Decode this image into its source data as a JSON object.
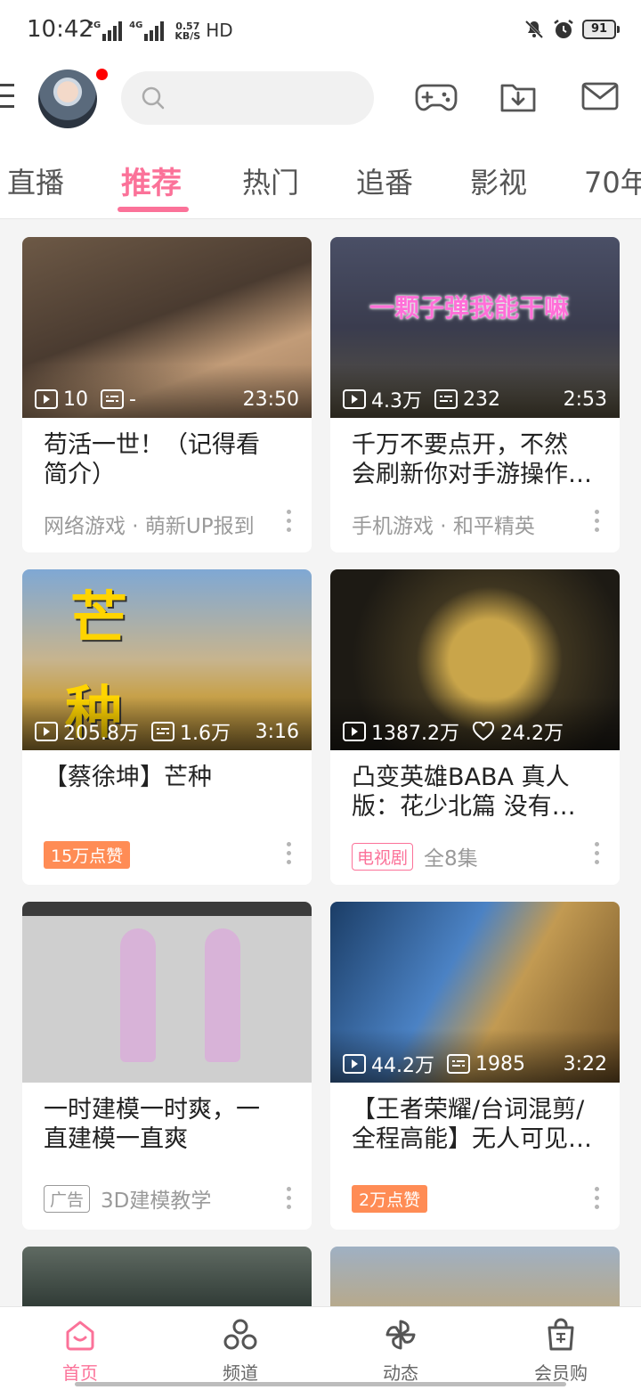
{
  "status_bar": {
    "time": "10:42",
    "net_1": "2G",
    "net_2": "4G",
    "speed_value": "0.57",
    "speed_unit": "KB/S",
    "hd": "HD",
    "battery": "91"
  },
  "header": {
    "search_placeholder": "",
    "icons": [
      "game-controller-icon",
      "download-icon",
      "mail-icon"
    ]
  },
  "tabs": [
    {
      "label": "直播"
    },
    {
      "label": "推荐"
    },
    {
      "label": "热门"
    },
    {
      "label": "追番"
    },
    {
      "label": "影视"
    },
    {
      "label": "70年"
    }
  ],
  "active_tab": "推荐",
  "feed": [
    {
      "views": "10",
      "danmaku": "-",
      "duration": "23:50",
      "title": "苟活一世！（记得看\n简介）",
      "sub": "网络游戏 · 萌新UP报到"
    },
    {
      "views": "4.3万",
      "danmaku": "232",
      "duration": "2:53",
      "thumb_text": "一颗子弹我能干嘛",
      "title": "千万不要点开，不然\n会刷新你对手游操作…",
      "sub": "手机游戏 · 和平精英"
    },
    {
      "views": "205.8万",
      "danmaku": "1.6万",
      "duration": "3:16",
      "thumb_chars": [
        "芒",
        "种"
      ],
      "title": "【蔡徐坤】芒种",
      "badge": "15万点赞"
    },
    {
      "views": "1387.2万",
      "likes": "24.2万",
      "title": "凸变英雄BABA 真人\n版：花少北篇 没有…",
      "badge": "电视剧",
      "sub": "全8集"
    },
    {
      "title": "一时建模一时爽，一\n直建模一直爽",
      "badge": "广告",
      "sub": "3D建模教学"
    },
    {
      "views": "44.2万",
      "danmaku": "1985",
      "duration": "3:22",
      "title": "【王者荣耀/台词混剪/\n全程高能】无人可见…",
      "badge": "2万点赞"
    }
  ],
  "bottom_nav": [
    {
      "label": "首页",
      "icon": "home-icon"
    },
    {
      "label": "频道",
      "icon": "channel-icon"
    },
    {
      "label": "动态",
      "icon": "pinwheel-icon"
    },
    {
      "label": "会员购",
      "icon": "shopping-bag-icon"
    }
  ],
  "colors": {
    "accent": "#fb7299",
    "badge_orange": "#ff8c55",
    "background": "#f4f4f4"
  }
}
